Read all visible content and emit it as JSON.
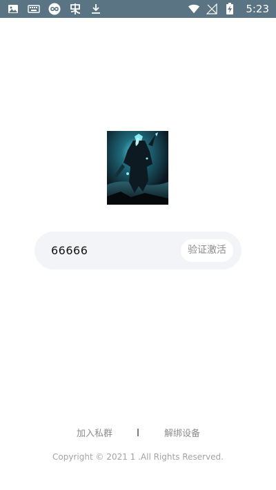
{
  "status_bar": {
    "time": "5:23",
    "left_icons": [
      "image-icon",
      "keyboard-icon",
      "infinity-icon",
      "app-icon",
      "download-icon"
    ],
    "right_icons": [
      "wifi-icon",
      "signal-icon",
      "battery-charging-icon"
    ]
  },
  "cover": {
    "icon": "dark-knight-artwork"
  },
  "activation": {
    "code_value": "66666",
    "verify_button_label": "验证激活"
  },
  "footer": {
    "join_group_label": "加入私群",
    "unbind_device_label": "解绑设备",
    "copyright": "Copyright © 2021 1 .All Rights Reserved."
  },
  "colors": {
    "status_bar": "#5b7483",
    "input_bg": "#f3f4f8",
    "button_bg": "#ffffff",
    "muted_text": "#8c8c8c"
  }
}
